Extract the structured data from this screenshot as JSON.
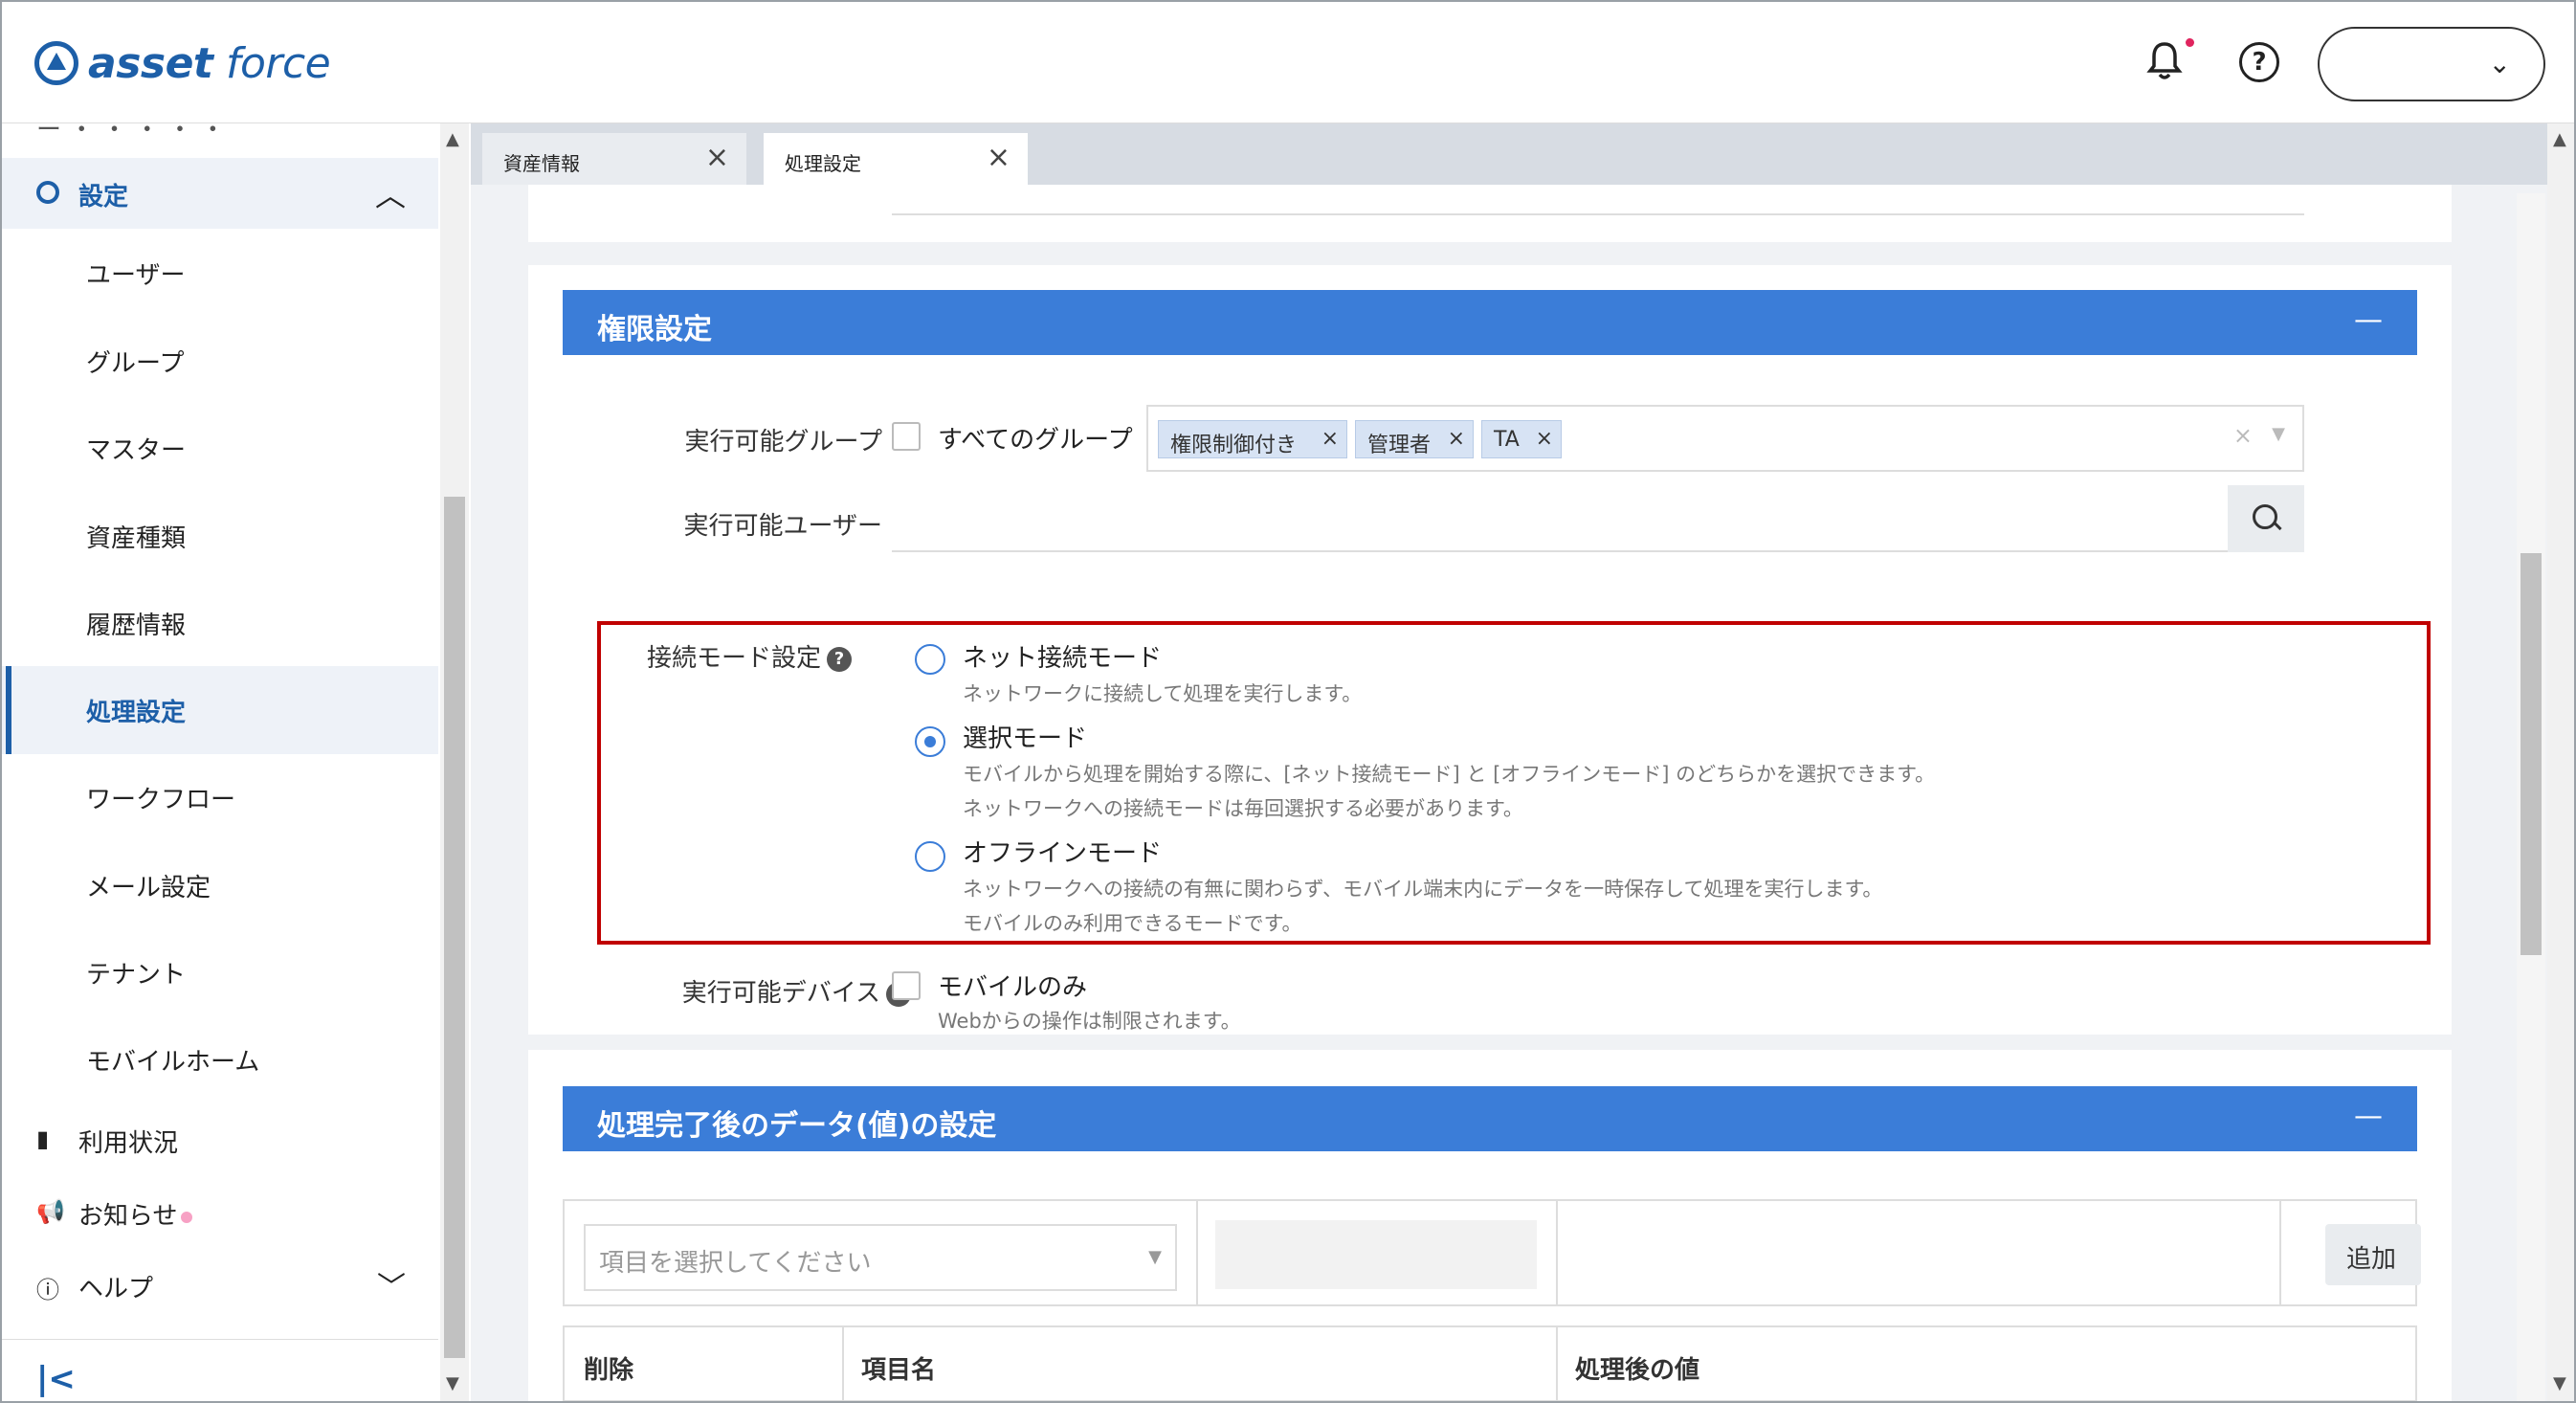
{
  "header": {
    "logo_text_bold": "asset",
    "logo_text": "force",
    "bell_icon": "bell-icon",
    "help_icon": "help-circle-icon",
    "user_value": ""
  },
  "sidebar": {
    "cut_item": "ー ・ ・ ・ ・ ・",
    "group_label": "設定",
    "items": [
      {
        "label": "ユーザー"
      },
      {
        "label": "グループ"
      },
      {
        "label": "マスター"
      },
      {
        "label": "資産種類"
      },
      {
        "label": "履歴情報"
      },
      {
        "label": "処理設定",
        "active": true
      },
      {
        "label": "ワークフロー"
      },
      {
        "label": "メール設定"
      },
      {
        "label": "テナント"
      },
      {
        "label": "モバイルホーム"
      }
    ],
    "usage": "利用状況",
    "notice": "お知らせ",
    "help": "ヘルプ",
    "collapse": "|<"
  },
  "tabs": [
    {
      "label": "資産情報",
      "active": false
    },
    {
      "label": "処理設定",
      "active": true
    }
  ],
  "permission": {
    "title": "権限設定",
    "collapse": "—",
    "exec_group_label": "実行可能グループ",
    "all_groups_label": "すべてのグループ",
    "tags": [
      "権限制御付き",
      "管理者",
      "TA"
    ],
    "exec_user_label": "実行可能ユーザー",
    "connection_mode_label": "接続モード設定",
    "modes": [
      {
        "label": "ネット接続モード",
        "desc": [
          "ネットワークに接続して処理を実行します。"
        ],
        "selected": false
      },
      {
        "label": "選択モード",
        "desc": [
          "モバイルから処理を開始する際に、[ネット接続モード] と [オフラインモード] のどちらかを選択できます。",
          "ネットワークへの接続モードは毎回選択する必要があります。"
        ],
        "selected": true
      },
      {
        "label": "オフラインモード",
        "desc": [
          "ネットワークへの接続の有無に関わらず、モバイル端末内にデータを一時保存して処理を実行します。",
          "モバイルのみ利用できるモードです。"
        ],
        "selected": false
      }
    ],
    "device_label": "実行可能デバイス",
    "mobile_only_label": "モバイルのみ",
    "mobile_only_desc": "Webからの操作は制限されます。"
  },
  "post_process": {
    "title": "処理完了後のデータ(値)の設定",
    "collapse": "—",
    "select_placeholder": "項目を選択してください",
    "add_label": "追加",
    "columns": [
      "削除",
      "項目名",
      "処理後の値"
    ]
  },
  "colors": {
    "accent": "#3b7dd8",
    "brand": "#1d5fa8",
    "highlight_border": "#c00000"
  }
}
